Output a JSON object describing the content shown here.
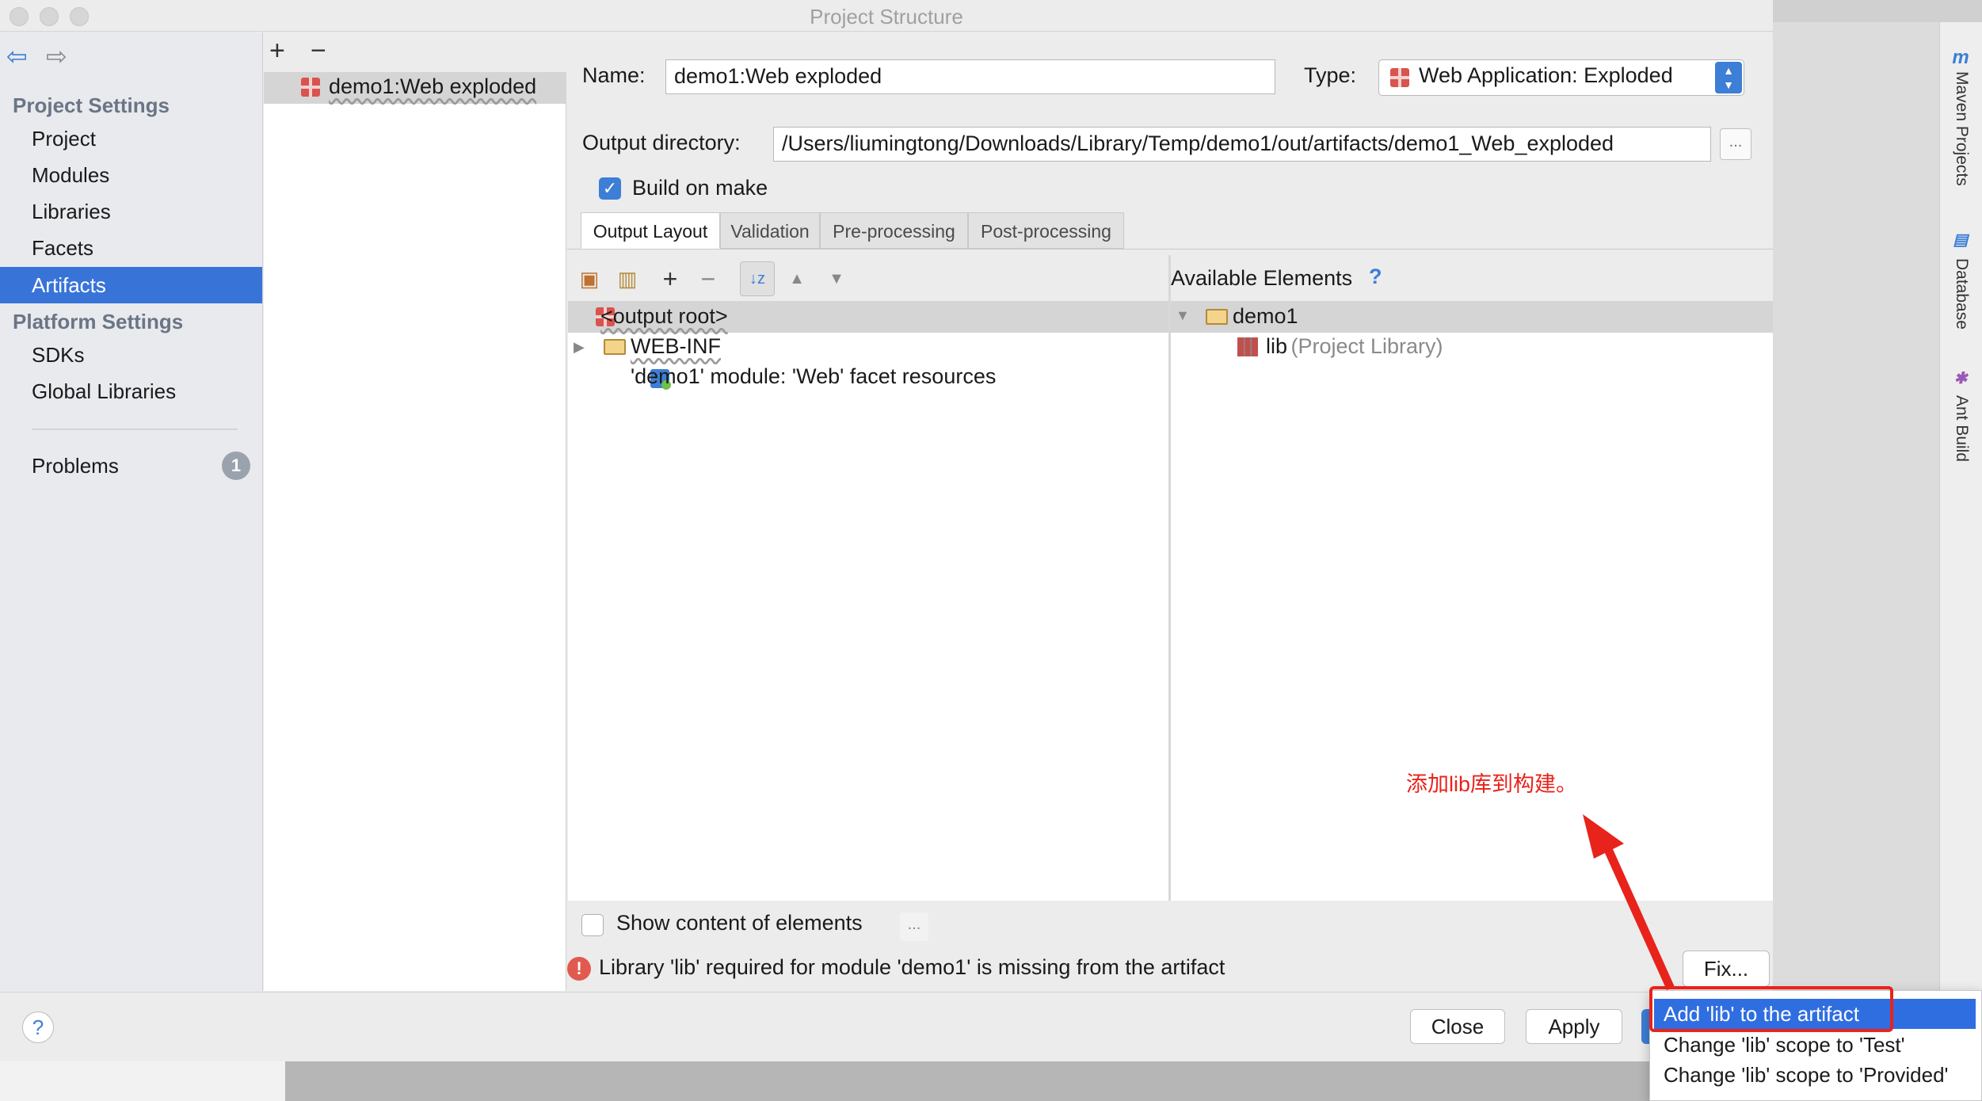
{
  "window": {
    "title": "Project Structure"
  },
  "nav": {
    "project_settings_header": "Project Settings",
    "project_items": [
      "Project",
      "Modules",
      "Libraries",
      "Facets",
      "Artifacts"
    ],
    "platform_settings_header": "Platform Settings",
    "platform_items": [
      "SDKs",
      "Global Libraries"
    ],
    "problems_label": "Problems",
    "problems_count": "1",
    "selected": "Artifacts"
  },
  "artifacts": {
    "add_label": "+",
    "remove_label": "−",
    "items": [
      "demo1:Web exploded"
    ]
  },
  "main": {
    "name_label": "Name:",
    "name_value": "demo1:Web exploded",
    "type_label": "Type:",
    "type_value": "Web Application: Exploded",
    "output_dir_label": "Output directory:",
    "output_dir_value": "/Users/liumingtong/Downloads/Library/Temp/demo1/out/artifacts/demo1_Web_exploded",
    "browse_label": "...",
    "build_on_make_label": "Build on make",
    "build_on_make_checked": true,
    "tabs": [
      "Output Layout",
      "Validation",
      "Pre-processing",
      "Post-processing"
    ],
    "active_tab": "Output Layout"
  },
  "output_tree": [
    {
      "label": "<output root>",
      "icon": "artifact-icon"
    },
    {
      "label": "WEB-INF",
      "icon": "folder-icon"
    },
    {
      "label": "'demo1' module: 'Web' facet resources",
      "icon": "module-icon"
    }
  ],
  "available": {
    "header": "Available Elements",
    "help": "?",
    "items": [
      {
        "label": "demo1",
        "icon": "folder-icon"
      },
      {
        "label": "lib",
        "suffix": "(Project Library)",
        "icon": "library-icon"
      }
    ]
  },
  "footer": {
    "show_content_label": "Show content of elements",
    "show_content_more": "...",
    "error_message": "Library 'lib' required for module 'demo1' is missing from the artifact",
    "fix_label": "Fix..."
  },
  "buttons": {
    "help": "?",
    "close": "Close",
    "apply": "Apply"
  },
  "popup": {
    "items": [
      "Add 'lib' to the artifact",
      "Change 'lib' scope to 'Test'",
      "Change 'lib' scope to 'Provided'"
    ]
  },
  "annotation": {
    "text": "添加lib库到构建。"
  },
  "side_tools": [
    "Maven Projects",
    "Database",
    "Ant Build"
  ],
  "colors": {
    "accent": "#3874d8",
    "annotation_red": "#e8231b",
    "error_red": "#e15a4f"
  }
}
